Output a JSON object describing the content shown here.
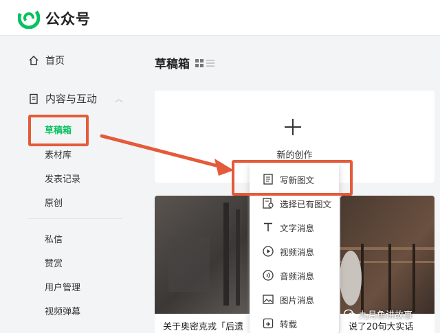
{
  "header": {
    "brand": "公众号"
  },
  "sidebar": {
    "home": "首页",
    "content": "内容与互动",
    "sub_items": [
      "草稿箱",
      "素材库",
      "发表记录",
      "原创"
    ],
    "other_items": [
      "私信",
      "赞赏",
      "用户管理",
      "视频弹幕"
    ]
  },
  "main": {
    "title": "草稿箱",
    "create_label": "新的创作",
    "articles": [
      {
        "caption": "关于奥密克戎「后遗"
      },
      {
        "caption": "说了20句大实话"
      }
    ]
  },
  "menu": {
    "items": [
      {
        "label": "写新图文",
        "icon": "document-icon"
      },
      {
        "label": "选择已有图文",
        "icon": "document-select-icon"
      },
      {
        "label": "文字消息",
        "icon": "text-icon"
      },
      {
        "label": "视频消息",
        "icon": "play-icon"
      },
      {
        "label": "音频消息",
        "icon": "audio-icon"
      },
      {
        "label": "图片消息",
        "icon": "image-icon"
      },
      {
        "label": "转载",
        "icon": "repost-icon"
      }
    ]
  },
  "watermark": {
    "text": "九月鱼讲故事"
  },
  "colors": {
    "accent": "#07c160",
    "highlight": "#e35b3a"
  }
}
